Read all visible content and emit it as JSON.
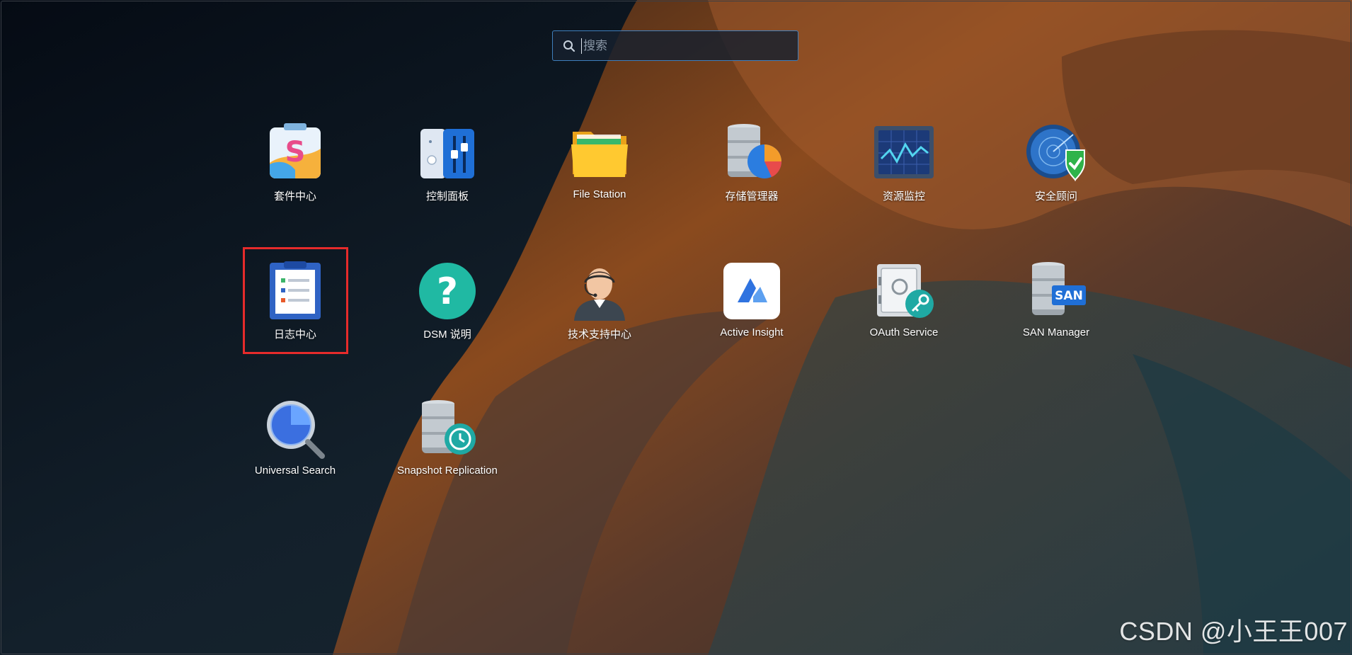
{
  "search": {
    "placeholder": "搜索"
  },
  "apps": [
    {
      "label": "套件中心",
      "icon": "package-center-icon"
    },
    {
      "label": "控制面板",
      "icon": "control-panel-icon"
    },
    {
      "label": "File Station",
      "icon": "file-station-icon"
    },
    {
      "label": "存储管理器",
      "icon": "storage-manager-icon"
    },
    {
      "label": "资源监控",
      "icon": "resource-monitor-icon"
    },
    {
      "label": "安全顾问",
      "icon": "security-advisor-icon"
    },
    {
      "label": "日志中心",
      "icon": "log-center-icon",
      "highlighted": true
    },
    {
      "label": "DSM 说明",
      "icon": "dsm-help-icon"
    },
    {
      "label": "技术支持中心",
      "icon": "support-center-icon"
    },
    {
      "label": "Active Insight",
      "icon": "active-insight-icon"
    },
    {
      "label": "OAuth Service",
      "icon": "oauth-service-icon"
    },
    {
      "label": "SAN Manager",
      "icon": "san-manager-icon"
    },
    {
      "label": "Universal Search",
      "icon": "universal-search-icon"
    },
    {
      "label": "Snapshot Replication",
      "icon": "snapshot-replication-icon"
    }
  ],
  "icon_badges": {
    "san": "SAN"
  },
  "watermark": "CSDN @小王王007",
  "colors": {
    "highlight": "#e62b2b",
    "search_border": "#3f7fbd",
    "label": "#ffffff"
  }
}
